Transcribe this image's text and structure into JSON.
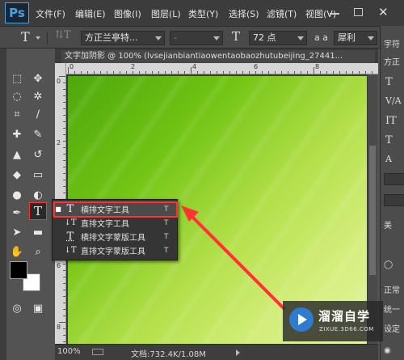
{
  "app": {
    "logo_text": "Ps"
  },
  "menu": [
    {
      "label": "文件(F)"
    },
    {
      "label": "编辑(E)"
    },
    {
      "label": "图像(I)"
    },
    {
      "label": "图层(L)"
    },
    {
      "label": "类型(Y)"
    },
    {
      "label": "选择(S)"
    },
    {
      "label": "滤镜(T)"
    },
    {
      "label": "视图(V)"
    }
  ],
  "options": {
    "tool_glyph": "T",
    "orient_glyph": "⇅T",
    "font_family": "方正兰亭特...",
    "font_style": "-",
    "size_glyph": "T",
    "font_size": "72 点",
    "aa_glyph": "a a",
    "anti_alias": "犀利"
  },
  "document": {
    "tab_title": "文字加阴影 @ 100% (lvsejianbiantiaowentaobaozhutubeijing_27441..."
  },
  "rulers": {
    "top_labels": [
      "0",
      "2",
      "4",
      "6",
      "8"
    ],
    "left_labels": [
      "0",
      "2",
      "4",
      "6",
      "8"
    ]
  },
  "flyout": {
    "items": [
      {
        "icon": "T",
        "label": "横排文字工具",
        "key": "T",
        "selected": true
      },
      {
        "icon": "↓T",
        "label": "直排文字工具",
        "key": "T",
        "selected": false
      },
      {
        "icon": "T",
        "label": "横排文字蒙版工具",
        "key": "T",
        "selected": false
      },
      {
        "icon": "↓T",
        "label": "直排文字蒙版工具",
        "key": "T",
        "selected": false
      }
    ]
  },
  "status": {
    "zoom": "100%",
    "doc_info": "文档:732.4K/1.08M"
  },
  "right_panel": {
    "tab_label": "字符",
    "font_prefix": "方正",
    "label_justify": "正常",
    "label_unified": "统一",
    "label_setting": "设定",
    "beside_btn": "美"
  },
  "watermark": {
    "title": "溜溜自学",
    "url": "ZIXUE.3D66.COM"
  },
  "colors": {
    "accent_red": "#ff3333",
    "canvas_green": "#72c414",
    "fg_color": "#000000",
    "bg_color": "#ffffff"
  }
}
